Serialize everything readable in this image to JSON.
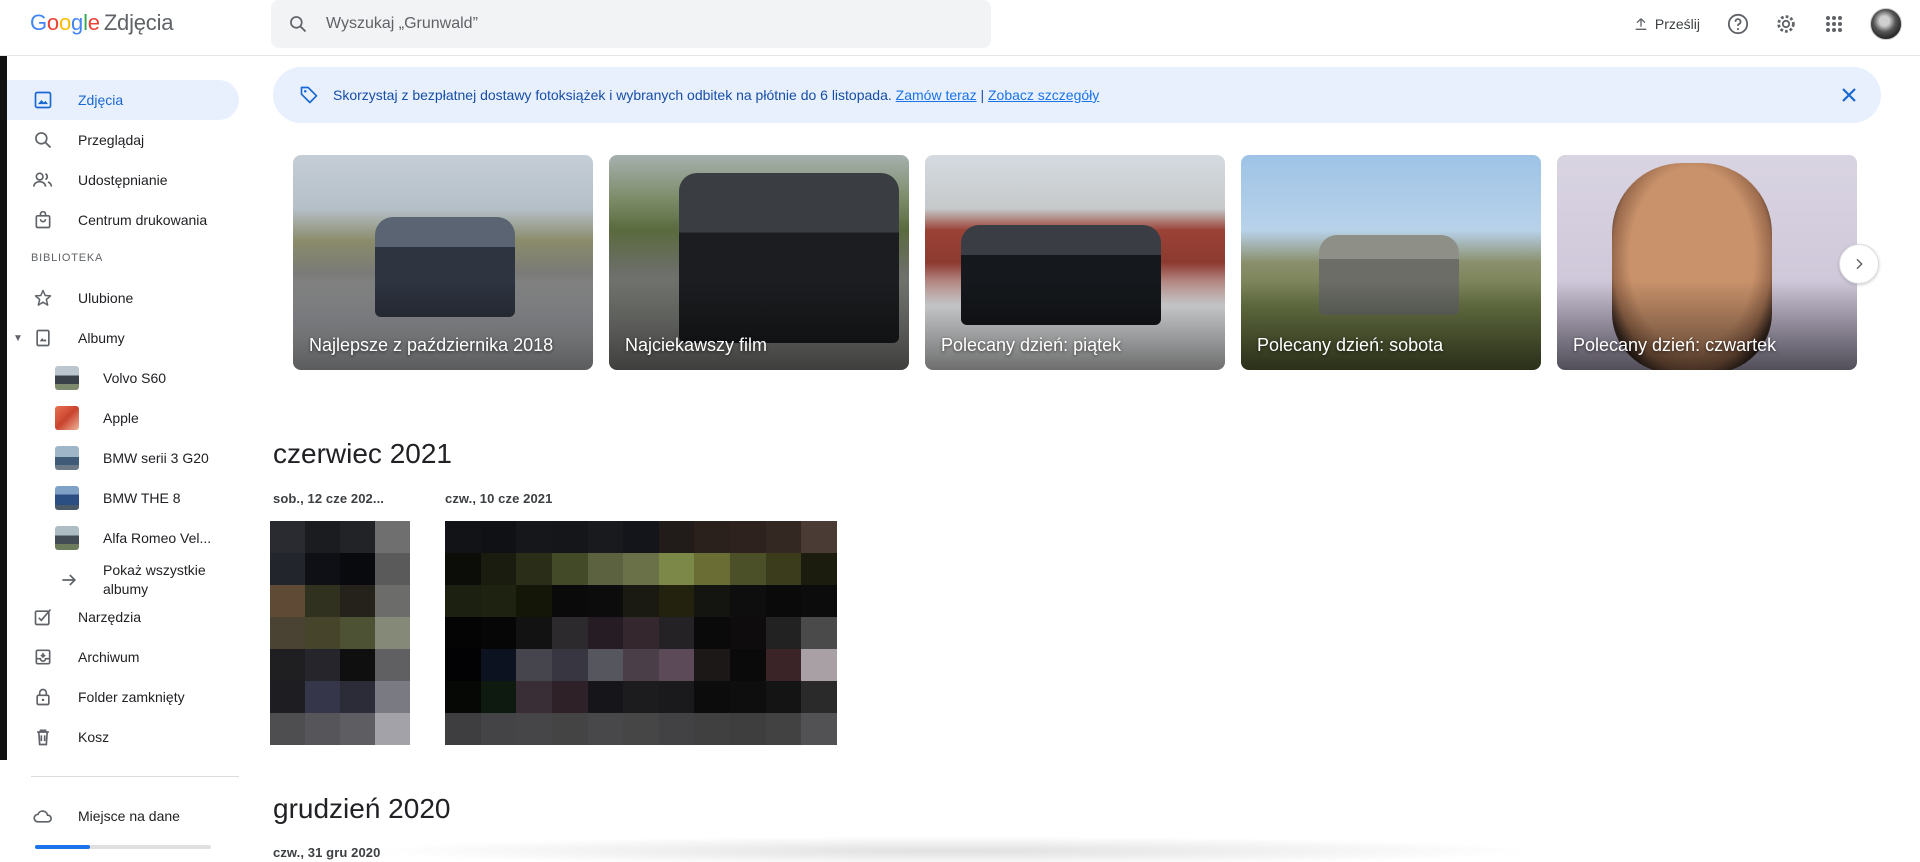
{
  "header": {
    "logo_google": "Google",
    "logo_product": "Zdjęcia",
    "search_placeholder": "Wyszukaj „Grunwald”",
    "upload_label": "Prześlij",
    "icons": [
      "search-icon",
      "upload-icon",
      "help-icon",
      "settings-icon",
      "apps-icon",
      "avatar"
    ]
  },
  "sidebar": {
    "items": [
      {
        "label": "Zdjęcia",
        "icon": "photo-icon",
        "active": true
      },
      {
        "label": "Przeglądaj",
        "icon": "search-icon"
      },
      {
        "label": "Udostępnianie",
        "icon": "people-icon"
      },
      {
        "label": "Centrum drukowania",
        "icon": "shopping-bag-icon"
      }
    ],
    "library_label": "BIBLIOTEKA",
    "library": [
      {
        "label": "Ulubione",
        "icon": "star-icon"
      },
      {
        "label": "Albumy",
        "icon": "album-icon"
      }
    ],
    "albums": [
      {
        "label": "Volvo S60"
      },
      {
        "label": "Apple"
      },
      {
        "label": "BMW serii 3 G20"
      },
      {
        "label": "BMW THE 8"
      },
      {
        "label": "Alfa Romeo Vel..."
      }
    ],
    "show_all": "Pokaż wszystkie albumy",
    "tools": [
      {
        "label": "Narzędzia",
        "icon": "tools-icon"
      },
      {
        "label": "Archiwum",
        "icon": "archive-icon"
      },
      {
        "label": "Folder zamknięty",
        "icon": "lock-icon"
      },
      {
        "label": "Kosz",
        "icon": "trash-icon"
      }
    ],
    "storage_label": "Miejsce na dane",
    "storage_used_fraction": 0.31
  },
  "banner": {
    "text": "Skorzystaj z bezpłatnej dostawy fotoksiążek i wybranych odbitek na płótnie do 6 listopada.",
    "link1": "Zamów teraz",
    "separator": "|",
    "link2": "Zobacz szczegóły"
  },
  "memories": [
    {
      "caption": "Najlepsze z października 2018"
    },
    {
      "caption": "Najciekawszy film"
    },
    {
      "caption": "Polecany dzień: piątek"
    },
    {
      "caption": "Polecany dzień: sobota"
    },
    {
      "caption": "Polecany dzień: czwartek"
    }
  ],
  "timeline": {
    "month1": "czerwiec 2021",
    "day1": "sob., 12 cze 202...",
    "day2": "czw., 10 cze 2021",
    "month2": "grudzień 2020",
    "day3": "czw., 31 gru 2020"
  }
}
